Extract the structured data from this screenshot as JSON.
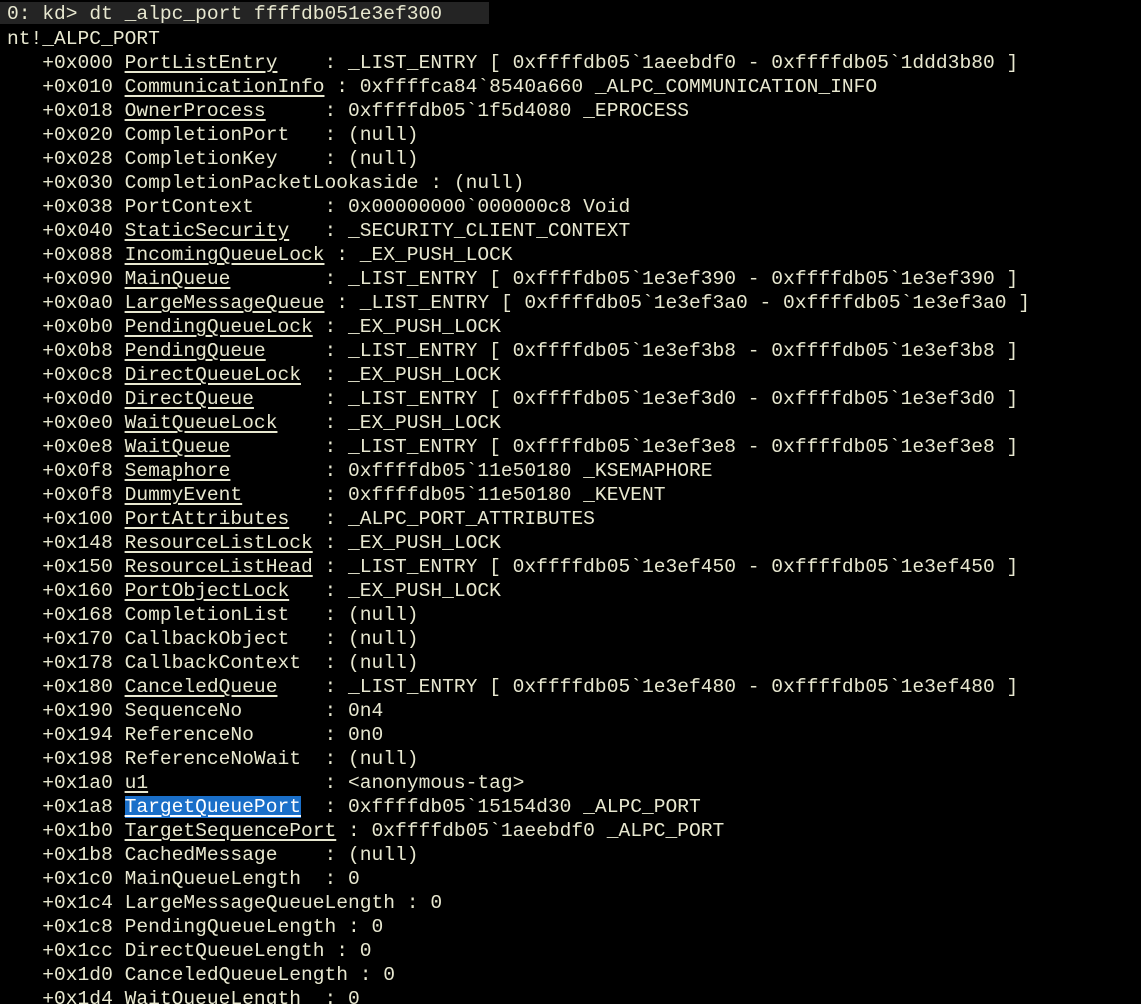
{
  "command": {
    "prompt": "0: kd>",
    "text": " dt _alpc_port ffffdb051e3ef300"
  },
  "type_name": "nt!_ALPC_PORT",
  "colors": {
    "background": "#000000",
    "text": "#e8e8d0",
    "selection": "#1a6fc9",
    "command_bar": "#242424"
  },
  "fields": [
    {
      "offset": "+0x000",
      "name": "PortListEntry",
      "sep": "    : ",
      "value": "_LIST_ENTRY [ 0xffffdb05`1aeebdf0 - 0xffffdb05`1ddd3b80 ]",
      "link": true
    },
    {
      "offset": "+0x010",
      "name": "CommunicationInfo",
      "sep": " : ",
      "value": "0xffffca84`8540a660 _ALPC_COMMUNICATION_INFO",
      "link": true
    },
    {
      "offset": "+0x018",
      "name": "OwnerProcess",
      "sep": "     : ",
      "value": "0xffffdb05`1f5d4080 _EPROCESS",
      "link": true
    },
    {
      "offset": "+0x020",
      "name": "CompletionPort",
      "sep": "   : ",
      "value": "(null)",
      "link": false
    },
    {
      "offset": "+0x028",
      "name": "CompletionKey",
      "sep": "    : ",
      "value": "(null)",
      "link": false
    },
    {
      "offset": "+0x030",
      "name": "CompletionPacketLookaside",
      "sep": " : ",
      "value": "(null)",
      "link": false
    },
    {
      "offset": "+0x038",
      "name": "PortContext",
      "sep": "      : ",
      "value": "0x00000000`000000c8 Void",
      "link": false
    },
    {
      "offset": "+0x040",
      "name": "StaticSecurity",
      "sep": "   : ",
      "value": "_SECURITY_CLIENT_CONTEXT",
      "link": true
    },
    {
      "offset": "+0x088",
      "name": "IncomingQueueLock",
      "sep": " : ",
      "value": "_EX_PUSH_LOCK",
      "link": true
    },
    {
      "offset": "+0x090",
      "name": "MainQueue",
      "sep": "        : ",
      "value": "_LIST_ENTRY [ 0xffffdb05`1e3ef390 - 0xffffdb05`1e3ef390 ]",
      "link": true
    },
    {
      "offset": "+0x0a0",
      "name": "LargeMessageQueue",
      "sep": " : ",
      "value": "_LIST_ENTRY [ 0xffffdb05`1e3ef3a0 - 0xffffdb05`1e3ef3a0 ]",
      "link": true
    },
    {
      "offset": "+0x0b0",
      "name": "PendingQueueLock",
      "sep": " : ",
      "value": "_EX_PUSH_LOCK",
      "link": true
    },
    {
      "offset": "+0x0b8",
      "name": "PendingQueue",
      "sep": "     : ",
      "value": "_LIST_ENTRY [ 0xffffdb05`1e3ef3b8 - 0xffffdb05`1e3ef3b8 ]",
      "link": true
    },
    {
      "offset": "+0x0c8",
      "name": "DirectQueueLock",
      "sep": "  : ",
      "value": "_EX_PUSH_LOCK",
      "link": true
    },
    {
      "offset": "+0x0d0",
      "name": "DirectQueue",
      "sep": "      : ",
      "value": "_LIST_ENTRY [ 0xffffdb05`1e3ef3d0 - 0xffffdb05`1e3ef3d0 ]",
      "link": true
    },
    {
      "offset": "+0x0e0",
      "name": "WaitQueueLock",
      "sep": "    : ",
      "value": "_EX_PUSH_LOCK",
      "link": true
    },
    {
      "offset": "+0x0e8",
      "name": "WaitQueue",
      "sep": "        : ",
      "value": "_LIST_ENTRY [ 0xffffdb05`1e3ef3e8 - 0xffffdb05`1e3ef3e8 ]",
      "link": true
    },
    {
      "offset": "+0x0f8",
      "name": "Semaphore",
      "sep": "        : ",
      "value": "0xffffdb05`11e50180 _KSEMAPHORE",
      "link": true
    },
    {
      "offset": "+0x0f8",
      "name": "DummyEvent",
      "sep": "       : ",
      "value": "0xffffdb05`11e50180 _KEVENT",
      "link": true
    },
    {
      "offset": "+0x100",
      "name": "PortAttributes",
      "sep": "   : ",
      "value": "_ALPC_PORT_ATTRIBUTES",
      "link": true
    },
    {
      "offset": "+0x148",
      "name": "ResourceListLock",
      "sep": " : ",
      "value": "_EX_PUSH_LOCK",
      "link": true
    },
    {
      "offset": "+0x150",
      "name": "ResourceListHead",
      "sep": " : ",
      "value": "_LIST_ENTRY [ 0xffffdb05`1e3ef450 - 0xffffdb05`1e3ef450 ]",
      "link": true
    },
    {
      "offset": "+0x160",
      "name": "PortObjectLock",
      "sep": "   : ",
      "value": "_EX_PUSH_LOCK",
      "link": true
    },
    {
      "offset": "+0x168",
      "name": "CompletionList",
      "sep": "   : ",
      "value": "(null)",
      "link": false
    },
    {
      "offset": "+0x170",
      "name": "CallbackObject",
      "sep": "   : ",
      "value": "(null)",
      "link": false
    },
    {
      "offset": "+0x178",
      "name": "CallbackContext",
      "sep": "  : ",
      "value": "(null)",
      "link": false
    },
    {
      "offset": "+0x180",
      "name": "CanceledQueue",
      "sep": "    : ",
      "value": "_LIST_ENTRY [ 0xffffdb05`1e3ef480 - 0xffffdb05`1e3ef480 ]",
      "link": true
    },
    {
      "offset": "+0x190",
      "name": "SequenceNo",
      "sep": "       : ",
      "value": "0n4",
      "link": false
    },
    {
      "offset": "+0x194",
      "name": "ReferenceNo",
      "sep": "      : ",
      "value": "0n0",
      "link": false
    },
    {
      "offset": "+0x198",
      "name": "ReferenceNoWait",
      "sep": "  : ",
      "value": "(null)",
      "link": false
    },
    {
      "offset": "+0x1a0",
      "name": "u1",
      "sep": "               : ",
      "value": "<anonymous-tag>",
      "link": true
    },
    {
      "offset": "+0x1a8",
      "name": "TargetQueuePort",
      "sep": "  : ",
      "value": "0xffffdb05`15154d30 _ALPC_PORT",
      "link": true,
      "selected": true
    },
    {
      "offset": "+0x1b0",
      "name": "TargetSequencePort",
      "sep": " : ",
      "value": "0xffffdb05`1aeebdf0 _ALPC_PORT",
      "link": true
    },
    {
      "offset": "+0x1b8",
      "name": "CachedMessage",
      "sep": "    : ",
      "value": "(null)",
      "link": false
    },
    {
      "offset": "+0x1c0",
      "name": "MainQueueLength",
      "sep": "  : ",
      "value": "0",
      "link": false
    },
    {
      "offset": "+0x1c4",
      "name": "LargeMessageQueueLength",
      "sep": " : ",
      "value": "0",
      "link": false
    },
    {
      "offset": "+0x1c8",
      "name": "PendingQueueLength",
      "sep": " : ",
      "value": "0",
      "link": false
    },
    {
      "offset": "+0x1cc",
      "name": "DirectQueueLength",
      "sep": " : ",
      "value": "0",
      "link": false
    },
    {
      "offset": "+0x1d0",
      "name": "CanceledQueueLength",
      "sep": " : ",
      "value": "0",
      "link": false
    },
    {
      "offset": "+0x1d4",
      "name": "WaitQueueLength",
      "sep": "  : ",
      "value": "0",
      "link": false
    }
  ]
}
